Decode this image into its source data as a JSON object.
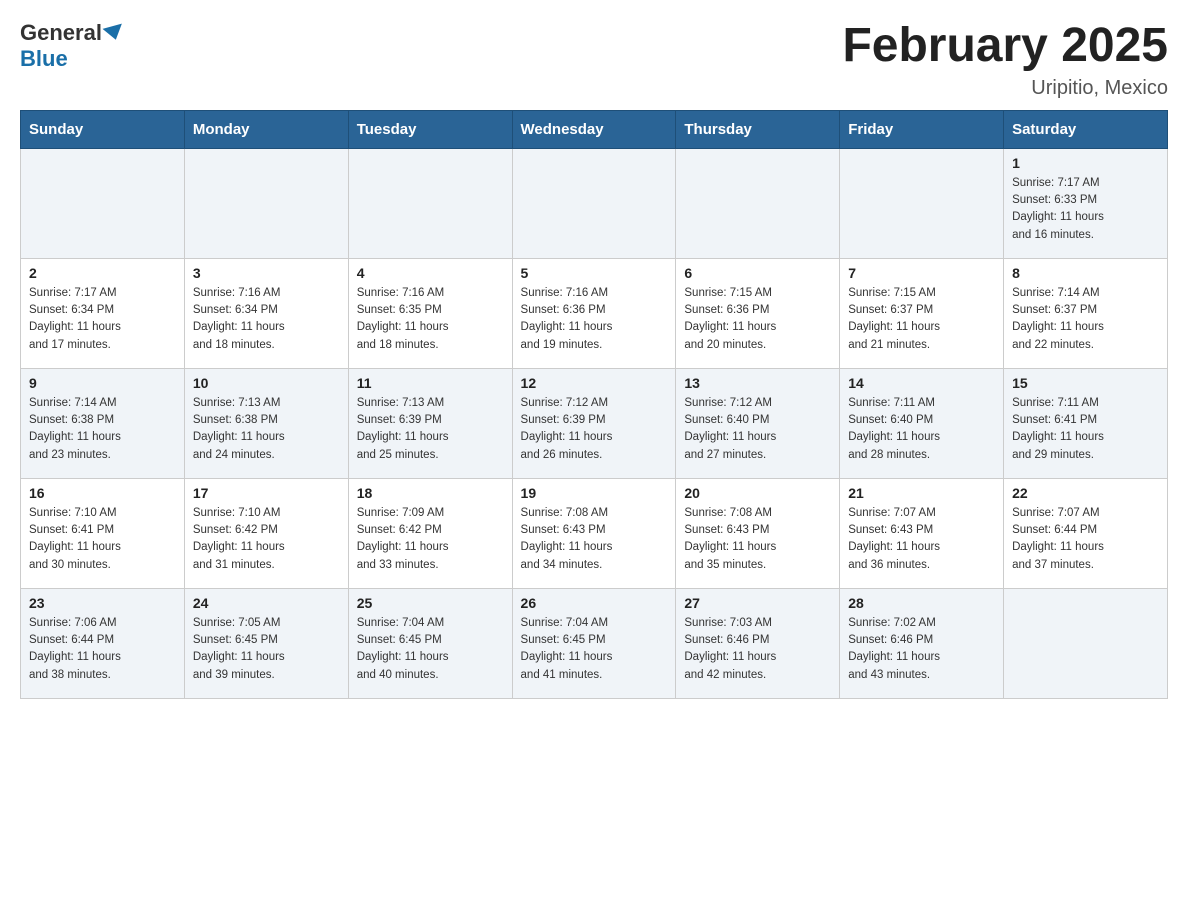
{
  "header": {
    "logo_general": "General",
    "logo_blue": "Blue",
    "month_title": "February 2025",
    "location": "Uripitio, Mexico"
  },
  "days_of_week": [
    "Sunday",
    "Monday",
    "Tuesday",
    "Wednesday",
    "Thursday",
    "Friday",
    "Saturday"
  ],
  "weeks": [
    [
      {
        "day": "",
        "info": ""
      },
      {
        "day": "",
        "info": ""
      },
      {
        "day": "",
        "info": ""
      },
      {
        "day": "",
        "info": ""
      },
      {
        "day": "",
        "info": ""
      },
      {
        "day": "",
        "info": ""
      },
      {
        "day": "1",
        "info": "Sunrise: 7:17 AM\nSunset: 6:33 PM\nDaylight: 11 hours\nand 16 minutes."
      }
    ],
    [
      {
        "day": "2",
        "info": "Sunrise: 7:17 AM\nSunset: 6:34 PM\nDaylight: 11 hours\nand 17 minutes."
      },
      {
        "day": "3",
        "info": "Sunrise: 7:16 AM\nSunset: 6:34 PM\nDaylight: 11 hours\nand 18 minutes."
      },
      {
        "day": "4",
        "info": "Sunrise: 7:16 AM\nSunset: 6:35 PM\nDaylight: 11 hours\nand 18 minutes."
      },
      {
        "day": "5",
        "info": "Sunrise: 7:16 AM\nSunset: 6:36 PM\nDaylight: 11 hours\nand 19 minutes."
      },
      {
        "day": "6",
        "info": "Sunrise: 7:15 AM\nSunset: 6:36 PM\nDaylight: 11 hours\nand 20 minutes."
      },
      {
        "day": "7",
        "info": "Sunrise: 7:15 AM\nSunset: 6:37 PM\nDaylight: 11 hours\nand 21 minutes."
      },
      {
        "day": "8",
        "info": "Sunrise: 7:14 AM\nSunset: 6:37 PM\nDaylight: 11 hours\nand 22 minutes."
      }
    ],
    [
      {
        "day": "9",
        "info": "Sunrise: 7:14 AM\nSunset: 6:38 PM\nDaylight: 11 hours\nand 23 minutes."
      },
      {
        "day": "10",
        "info": "Sunrise: 7:13 AM\nSunset: 6:38 PM\nDaylight: 11 hours\nand 24 minutes."
      },
      {
        "day": "11",
        "info": "Sunrise: 7:13 AM\nSunset: 6:39 PM\nDaylight: 11 hours\nand 25 minutes."
      },
      {
        "day": "12",
        "info": "Sunrise: 7:12 AM\nSunset: 6:39 PM\nDaylight: 11 hours\nand 26 minutes."
      },
      {
        "day": "13",
        "info": "Sunrise: 7:12 AM\nSunset: 6:40 PM\nDaylight: 11 hours\nand 27 minutes."
      },
      {
        "day": "14",
        "info": "Sunrise: 7:11 AM\nSunset: 6:40 PM\nDaylight: 11 hours\nand 28 minutes."
      },
      {
        "day": "15",
        "info": "Sunrise: 7:11 AM\nSunset: 6:41 PM\nDaylight: 11 hours\nand 29 minutes."
      }
    ],
    [
      {
        "day": "16",
        "info": "Sunrise: 7:10 AM\nSunset: 6:41 PM\nDaylight: 11 hours\nand 30 minutes."
      },
      {
        "day": "17",
        "info": "Sunrise: 7:10 AM\nSunset: 6:42 PM\nDaylight: 11 hours\nand 31 minutes."
      },
      {
        "day": "18",
        "info": "Sunrise: 7:09 AM\nSunset: 6:42 PM\nDaylight: 11 hours\nand 33 minutes."
      },
      {
        "day": "19",
        "info": "Sunrise: 7:08 AM\nSunset: 6:43 PM\nDaylight: 11 hours\nand 34 minutes."
      },
      {
        "day": "20",
        "info": "Sunrise: 7:08 AM\nSunset: 6:43 PM\nDaylight: 11 hours\nand 35 minutes."
      },
      {
        "day": "21",
        "info": "Sunrise: 7:07 AM\nSunset: 6:43 PM\nDaylight: 11 hours\nand 36 minutes."
      },
      {
        "day": "22",
        "info": "Sunrise: 7:07 AM\nSunset: 6:44 PM\nDaylight: 11 hours\nand 37 minutes."
      }
    ],
    [
      {
        "day": "23",
        "info": "Sunrise: 7:06 AM\nSunset: 6:44 PM\nDaylight: 11 hours\nand 38 minutes."
      },
      {
        "day": "24",
        "info": "Sunrise: 7:05 AM\nSunset: 6:45 PM\nDaylight: 11 hours\nand 39 minutes."
      },
      {
        "day": "25",
        "info": "Sunrise: 7:04 AM\nSunset: 6:45 PM\nDaylight: 11 hours\nand 40 minutes."
      },
      {
        "day": "26",
        "info": "Sunrise: 7:04 AM\nSunset: 6:45 PM\nDaylight: 11 hours\nand 41 minutes."
      },
      {
        "day": "27",
        "info": "Sunrise: 7:03 AM\nSunset: 6:46 PM\nDaylight: 11 hours\nand 42 minutes."
      },
      {
        "day": "28",
        "info": "Sunrise: 7:02 AM\nSunset: 6:46 PM\nDaylight: 11 hours\nand 43 minutes."
      },
      {
        "day": "",
        "info": ""
      }
    ]
  ]
}
